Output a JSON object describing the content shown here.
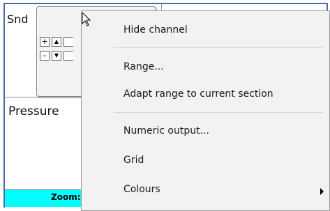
{
  "panels": {
    "top_label": "Snd",
    "bottom_label": "Pressure",
    "zoom_label": "Zoom:"
  },
  "mini_controls": {
    "plus": "+",
    "minus": "–",
    "up": "▲",
    "down": "▼"
  },
  "context_menu": {
    "items": [
      "Hide channel",
      "Range...",
      "Adapt range to current section",
      "Numeric output...",
      "Grid",
      "Colours"
    ]
  },
  "icons": {
    "cursor": "pointer-cursor-icon",
    "submenu": "submenu-arrow-icon"
  }
}
